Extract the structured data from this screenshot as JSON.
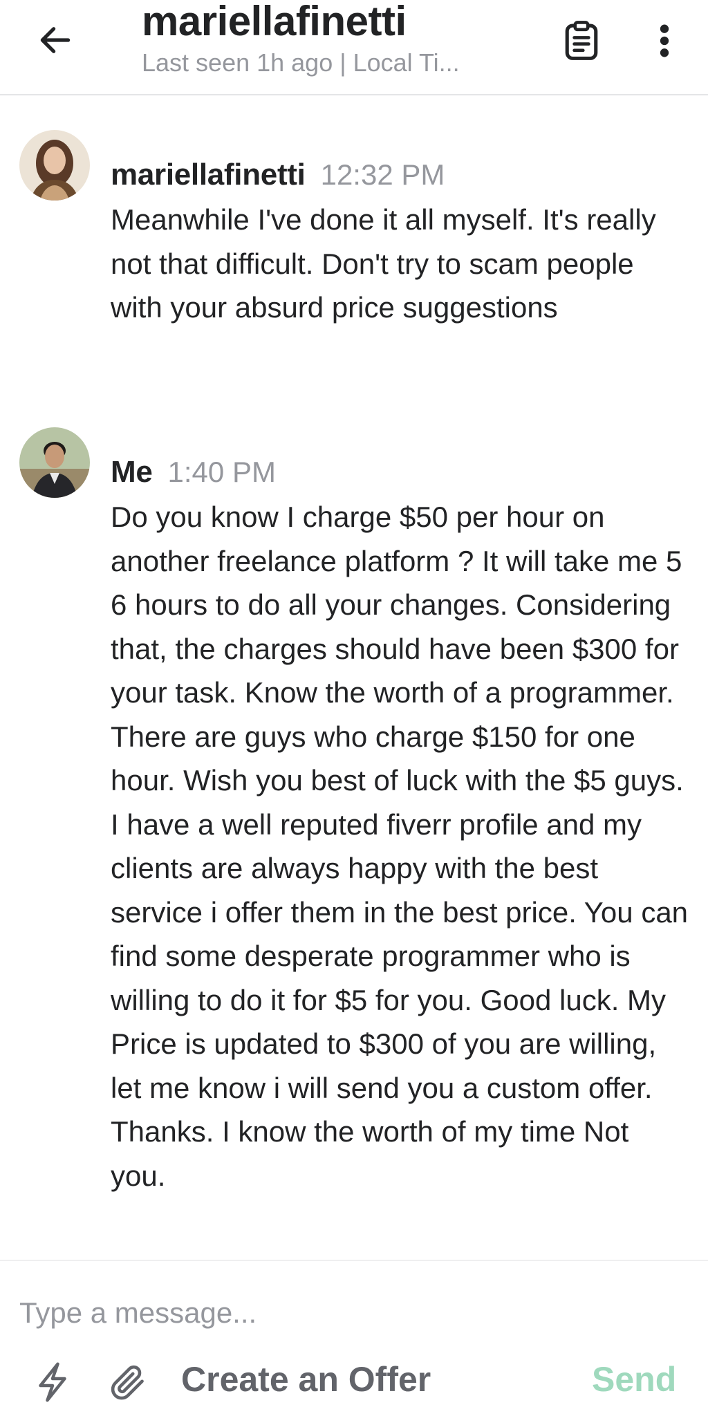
{
  "header": {
    "title": "mariellafinetti",
    "subtitle": "Last seen 1h ago | Local Ti..."
  },
  "messages": [
    {
      "sender": "mariellafinetti",
      "time": "12:32 PM",
      "text": "Meanwhile I've done it all myself. It's really not that difficult. Don't try to scam people with your absurd price suggestions"
    },
    {
      "sender": "Me",
      "time": "1:40 PM",
      "text": "Do you know I charge $50 per hour on another freelance platform ? It will take me 5 6 hours to do all your changes. Considering that, the charges should have been $300 for your task. Know the worth of a programmer. There are guys who charge $150 for one hour. Wish you best of luck with the $5 guys. I have a well reputed fiverr profile and my clients are always happy with the best service i offer them in the best price. You can find some desperate programmer who is willing to do it for $5 for you. Good luck. My Price is updated to $300 of you are willing, let me know i will send you a custom offer. Thanks. I know the worth of my time Not you."
    }
  ],
  "composer": {
    "placeholder": "Type a message...",
    "create_offer_label": "Create an Offer",
    "send_label": "Send"
  },
  "colors": {
    "text": "#222325",
    "muted": "#95979d",
    "send_disabled": "#9fd9bd"
  }
}
